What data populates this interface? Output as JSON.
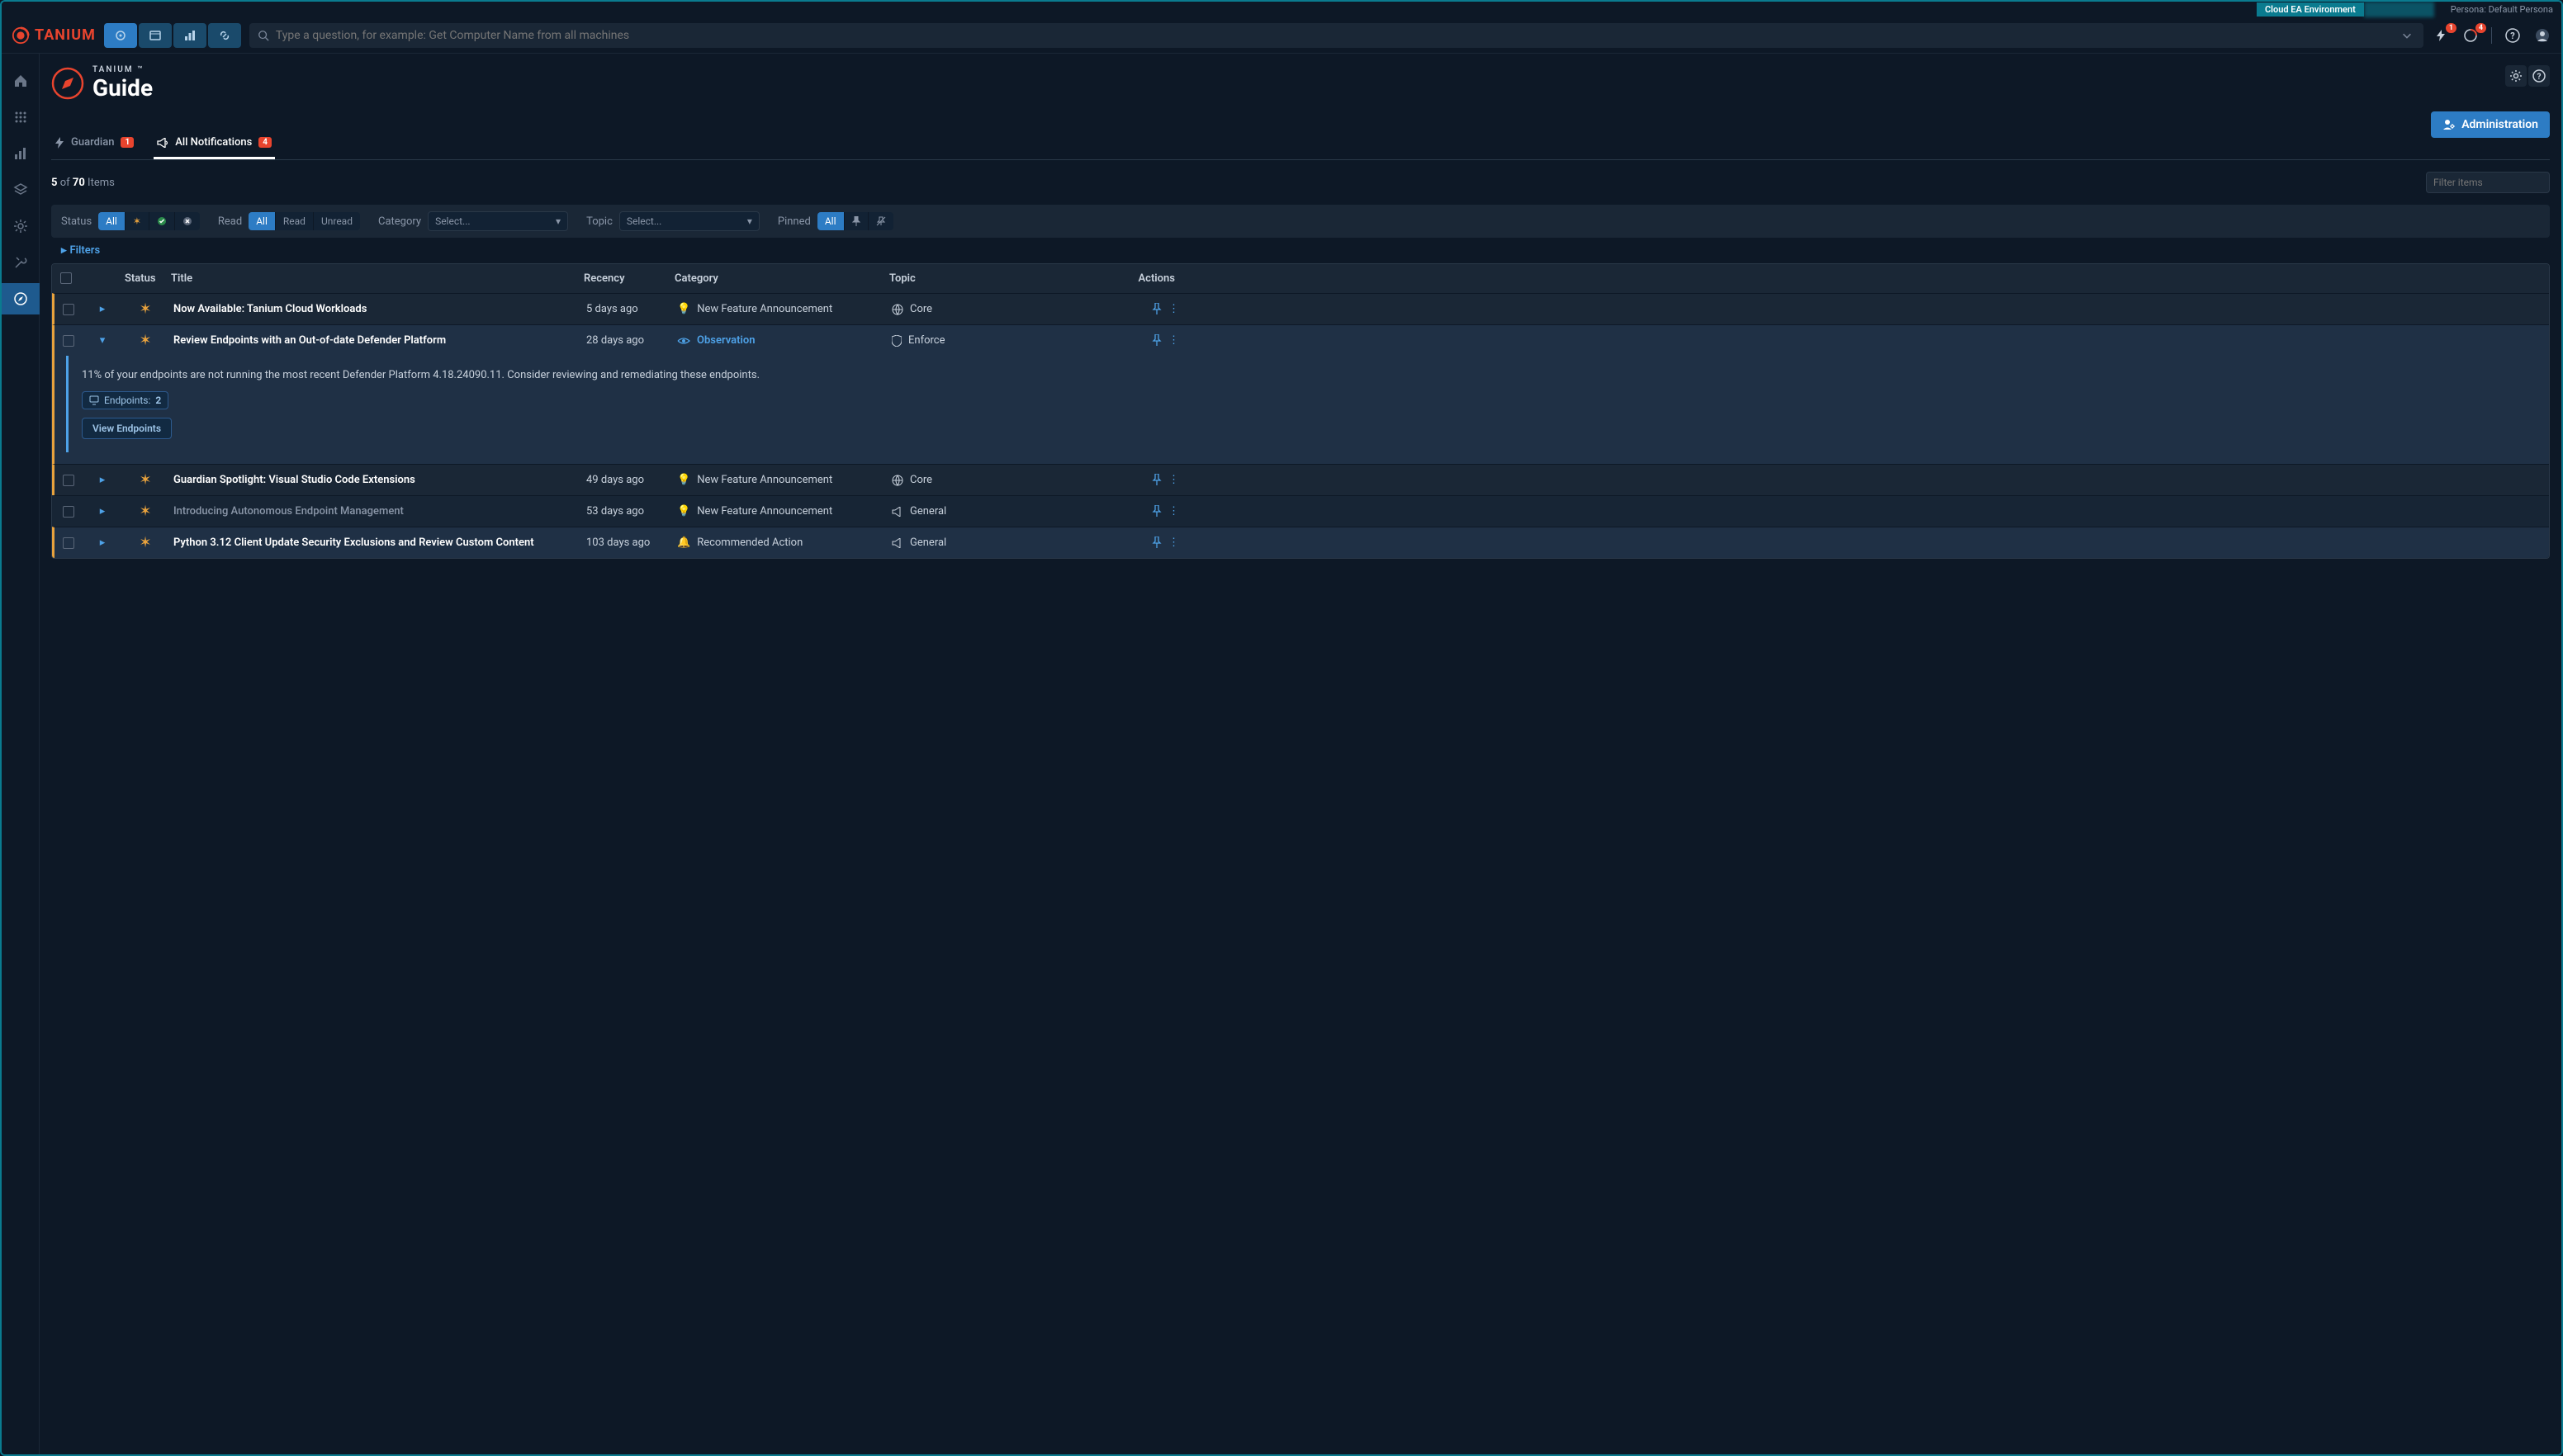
{
  "top_strip": {
    "env_label": "Cloud EA Environment",
    "persona_label": "Persona: Default Persona"
  },
  "header": {
    "brand": "TANIUM",
    "search_placeholder": "Type a question, for example: Get Computer Name from all machines",
    "notif1_count": "1",
    "notif2_count": "4"
  },
  "page": {
    "pre_title": "TANIUM ™",
    "title": "Guide",
    "admin_button": "Administration",
    "tabs": {
      "guardian_label": "Guardian",
      "guardian_badge": "1",
      "all_label": "All Notifications",
      "all_badge": "4"
    },
    "item_count": {
      "shown": "5",
      "of": "of",
      "total": "70",
      "suffix": "Items"
    },
    "filter_placeholder": "Filter items",
    "filterbar": {
      "status_label": "Status",
      "read_label": "Read",
      "category_label": "Category",
      "topic_label": "Topic",
      "pinned_label": "Pinned",
      "all": "All",
      "read": "Read",
      "unread": "Unread",
      "select_placeholder": "Select..."
    },
    "filters_toggle": "Filters",
    "columns": {
      "status": "Status",
      "title": "Title",
      "recency": "Recency",
      "category": "Category",
      "topic": "Topic",
      "actions": "Actions"
    },
    "rows": [
      {
        "title": "Now Available: Tanium Cloud Workloads",
        "recency": "5 days ago",
        "category": "New Feature Announcement",
        "topic": "Core",
        "bold": true
      },
      {
        "title": "Review Endpoints with an Out-of-date Defender Platform",
        "recency": "28 days ago",
        "category": "Observation",
        "topic": "Enforce",
        "bold": true,
        "expanded": true,
        "detail_text": "11% of your endpoints are not running the most recent Defender Platform 4.18.24090.11. Consider reviewing and remediating these endpoints.",
        "endpoints_label": "Endpoints:",
        "endpoints_count": "2",
        "view_button": "View Endpoints"
      },
      {
        "title": "Guardian Spotlight: Visual Studio Code Extensions",
        "recency": "49 days ago",
        "category": "New Feature Announcement",
        "topic": "Core",
        "bold": true
      },
      {
        "title": "Introducing Autonomous Endpoint Management",
        "recency": "53 days ago",
        "category": "New Feature Announcement",
        "topic": "General",
        "bold": false
      },
      {
        "title": "Python 3.12 Client Update Security Exclusions and Review Custom Content",
        "recency": "103 days ago",
        "category": "Recommended Action",
        "topic": "General",
        "bold": true
      }
    ]
  }
}
